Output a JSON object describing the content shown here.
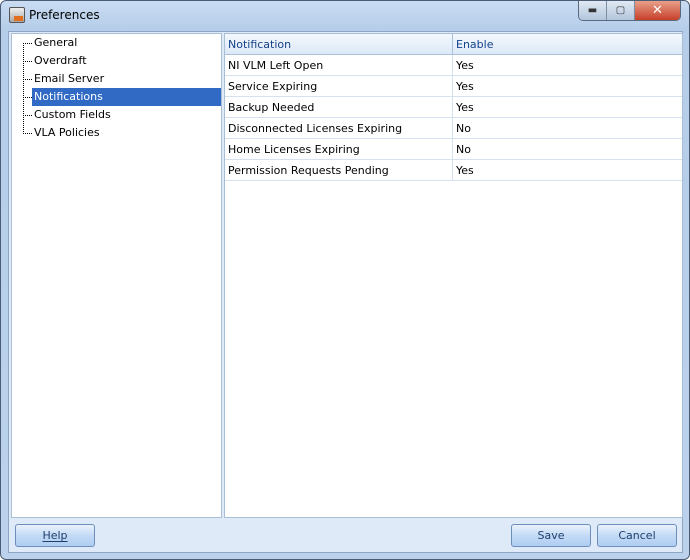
{
  "window": {
    "title": "Preferences"
  },
  "tree": {
    "items": [
      {
        "label": "General",
        "selected": false
      },
      {
        "label": "Overdraft",
        "selected": false
      },
      {
        "label": "Email Server",
        "selected": false
      },
      {
        "label": "Notifications",
        "selected": true
      },
      {
        "label": "Custom Fields",
        "selected": false
      },
      {
        "label": "VLA Policies",
        "selected": false
      }
    ]
  },
  "grid": {
    "columns": [
      "Notification",
      "Enable"
    ],
    "rows": [
      [
        "NI VLM Left Open",
        "Yes"
      ],
      [
        "Service Expiring",
        "Yes"
      ],
      [
        "Backup Needed",
        "Yes"
      ],
      [
        "Disconnected Licenses Expiring",
        "No"
      ],
      [
        "Home Licenses Expiring",
        "No"
      ],
      [
        "Permission Requests Pending",
        "Yes"
      ]
    ]
  },
  "buttons": {
    "help": "Help",
    "save": "Save",
    "cancel": "Cancel"
  },
  "colors": {
    "selection": "#316ac5",
    "header_text": "#15428b"
  }
}
